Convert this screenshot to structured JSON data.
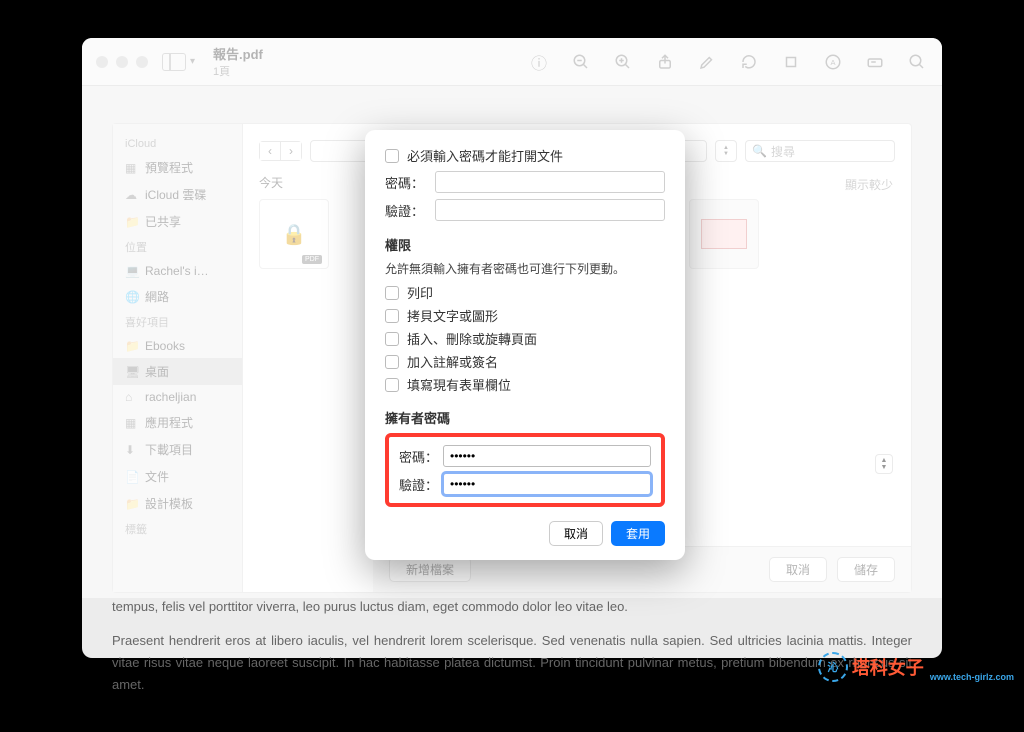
{
  "titlebar": {
    "filename": "報告.pdf",
    "subtitle": "1頁"
  },
  "toolbar_icons": [
    "info-icon",
    "zoom-out-icon",
    "zoom-in-icon",
    "share-icon",
    "markup-icon",
    "rotate-icon",
    "crop-icon",
    "text-icon",
    "highlight-icon",
    "search-icon"
  ],
  "sidebar": {
    "sections": [
      {
        "title": "iCloud",
        "items": [
          {
            "icon": "app-icon",
            "label": "預覽程式"
          },
          {
            "icon": "cloud-icon",
            "label": "iCloud 雲碟"
          },
          {
            "icon": "folder-icon",
            "label": "已共享"
          }
        ]
      },
      {
        "title": "位置",
        "items": [
          {
            "icon": "computer-icon",
            "label": "Rachel's i…"
          },
          {
            "icon": "globe-icon",
            "label": "網路"
          }
        ]
      },
      {
        "title": "喜好項目",
        "items": [
          {
            "icon": "folder-icon",
            "label": "Ebooks"
          },
          {
            "icon": "desktop-icon",
            "label": "桌面",
            "active": true
          },
          {
            "icon": "home-icon",
            "label": "racheljian"
          },
          {
            "icon": "app-icon",
            "label": "應用程式"
          },
          {
            "icon": "download-icon",
            "label": "下載項目"
          },
          {
            "icon": "doc-icon",
            "label": "文件"
          },
          {
            "icon": "folder-icon",
            "label": "設計模板"
          }
        ]
      },
      {
        "title": "標籤",
        "items": []
      }
    ]
  },
  "main": {
    "today": "今天",
    "showless": "顯示較少",
    "search_placeholder": "搜尋",
    "newfolder": "新增檔案",
    "cancel": "取消",
    "save": "儲存"
  },
  "sheet": {
    "require_label": "必須輸入密碼才能打開文件",
    "password_label": "密碼：",
    "verify_label": "驗證：",
    "password_value": "",
    "verify_value": "",
    "perm_title": "權限",
    "perm_sub": "允許無須輸入擁有者密碼也可進行下列更動。",
    "perms": [
      "列印",
      "拷貝文字或圖形",
      "插入、刪除或旋轉頁面",
      "加入註解或簽名",
      "填寫現有表單欄位"
    ],
    "owner_title": "擁有者密碼",
    "owner_password": "••••••",
    "owner_verify": "••••••",
    "cancel": "取消",
    "apply": "套用"
  },
  "bg_text": {
    "l1": "tempus, felis vel porttitor viverra, leo purus luctus diam, eget commodo dolor leo vitae leo.",
    "l2": "Praesent hendrerit eros at libero iaculis, vel hendrerit lorem scelerisque. Sed venenatis nulla sapien. Sed ultricies lacinia mattis. Integer vitae risus vitae neque laoreet suscipit. In hac habitasse platea dictumst. Proin tincidunt pulvinar metus, pretium bibendum ex rhoncus sit amet."
  },
  "watermark": {
    "brand": "塔科女子",
    "url": "www.tech-girlz.com"
  }
}
